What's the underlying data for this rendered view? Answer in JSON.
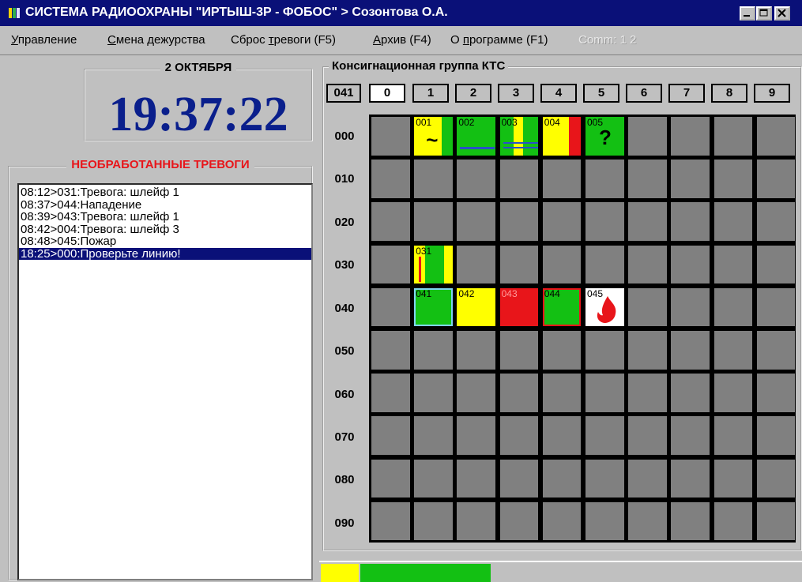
{
  "window": {
    "title": "СИСТЕМА РАДИООХРАНЫ \"ИРТЫШ-3Р - ФОБОС\" > Созонтова О.А."
  },
  "menu": {
    "items": [
      {
        "underline": "У",
        "rest": "правление"
      },
      {
        "underline": "С",
        "rest": "мена дежурства"
      },
      {
        "pre": "Сброс ",
        "underline": "т",
        "rest": "ревоги (F5)"
      },
      {
        "underline": "А",
        "rest": "рхив (F4)"
      },
      {
        "pre": "О ",
        "underline": "п",
        "rest": "рограмме (F1)"
      }
    ],
    "comm": "Comm: 1 2"
  },
  "clock": {
    "date": "2 ОКТЯБРЯ",
    "time": "19:37:22"
  },
  "alarms": {
    "title": "НЕОБРАБОТАННЫЕ ТРЕВОГИ",
    "items": [
      "08:12>031:Тревога: шлейф 1",
      "08:37>044:Нападение",
      "08:39>043:Тревога: шлейф 1",
      "08:42>004:Тревога: шлейф 3",
      "08:48>045:Пожар",
      "18:25>000:Проверьте линию!"
    ],
    "selected_index": 5
  },
  "group": {
    "title": "Консигнационная группа КТС",
    "current": "041",
    "columns": [
      "0",
      "1",
      "2",
      "3",
      "4",
      "5",
      "6",
      "7",
      "8",
      "9"
    ],
    "active_column": 0,
    "rows": [
      "000",
      "010",
      "020",
      "030",
      "040",
      "050",
      "060",
      "070",
      "080",
      "090"
    ]
  },
  "cells": {
    "c001": {
      "num": "001",
      "symbol": "~"
    },
    "c002": {
      "num": "002"
    },
    "c003": {
      "num": "003"
    },
    "c004": {
      "num": "004"
    },
    "c005": {
      "num": "005",
      "symbol": "?"
    },
    "c031": {
      "num": "031"
    },
    "c041": {
      "num": "041"
    },
    "c042": {
      "num": "042"
    },
    "c043": {
      "num": "043"
    },
    "c044": {
      "num": "044"
    },
    "c045": {
      "num": "045"
    }
  },
  "colors": {
    "titlebar": "#0a1078",
    "clock_text": "#0a1f8c",
    "alarm_title": "#e8151a",
    "selection": "#0a1078",
    "cell_empty": "#808080",
    "green": "#13c013",
    "yellow": "#ffff00",
    "red": "#e8151a"
  }
}
